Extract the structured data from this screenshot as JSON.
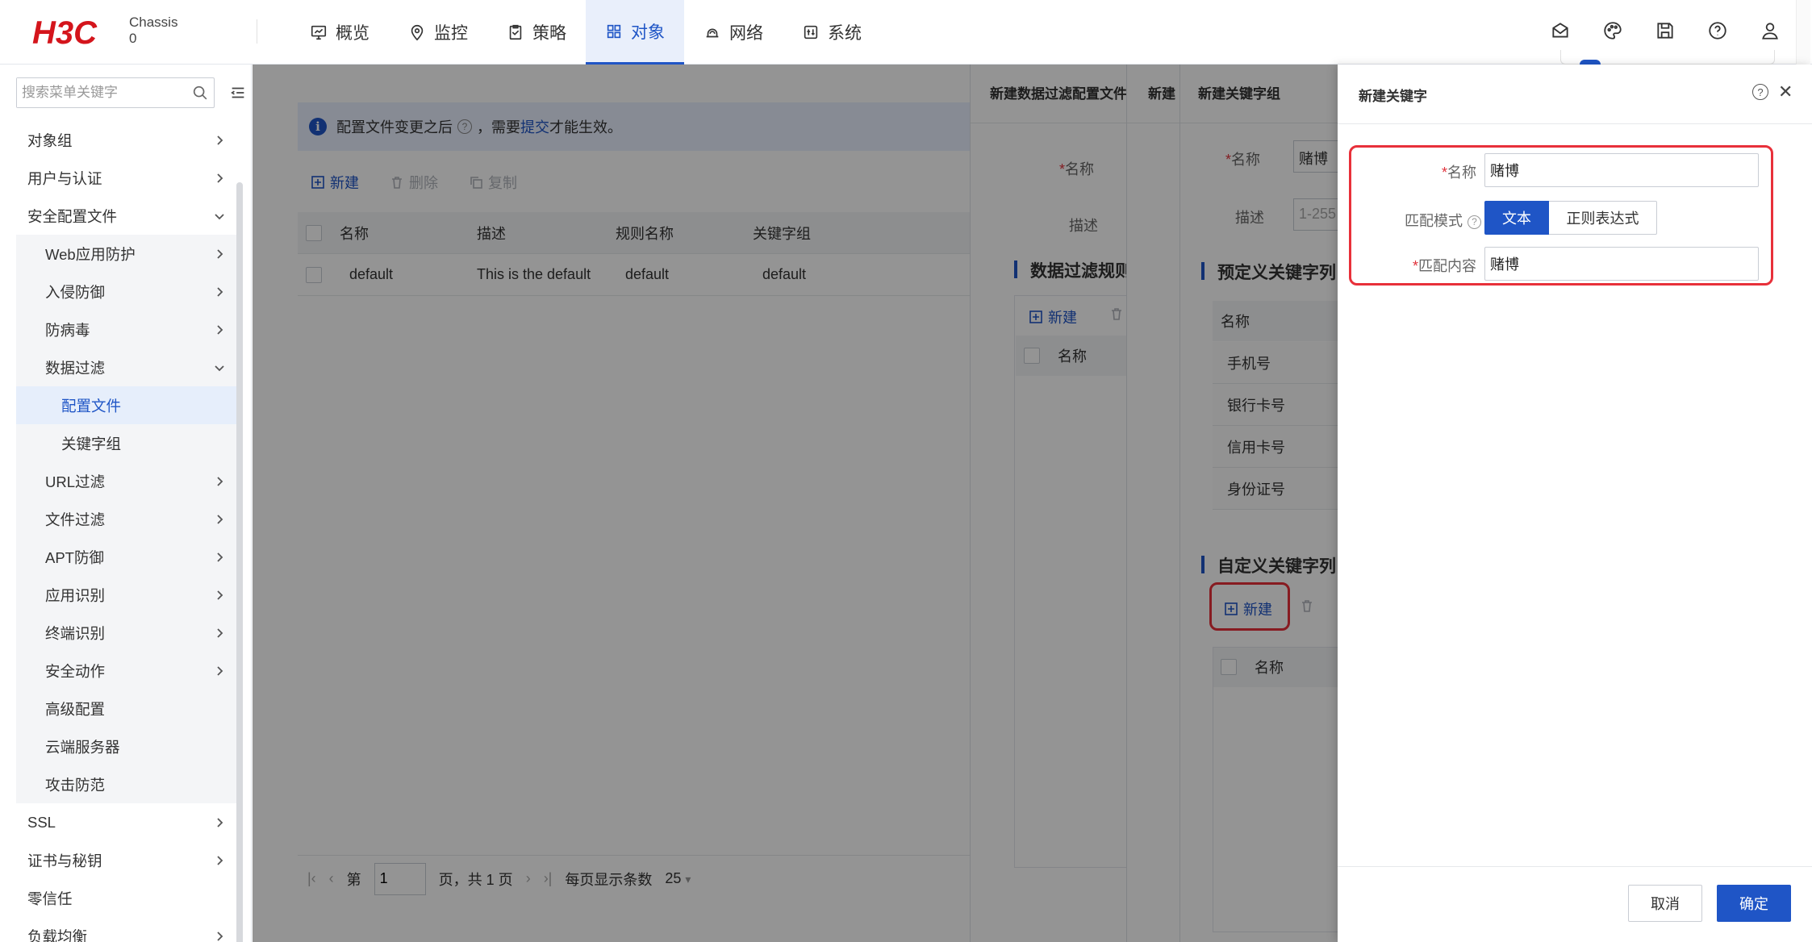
{
  "brand": {
    "logo": "H3C",
    "product": "Chassis",
    "slot": "0"
  },
  "nav": [
    {
      "label": "概览",
      "icon": "dashboard-icon"
    },
    {
      "label": "监控",
      "icon": "monitor-icon"
    },
    {
      "label": "策略",
      "icon": "policy-icon"
    },
    {
      "label": "对象",
      "icon": "object-icon",
      "active": true
    },
    {
      "label": "网络",
      "icon": "network-icon"
    },
    {
      "label": "系统",
      "icon": "system-icon"
    }
  ],
  "top_actions": [
    "message-icon",
    "theme-icon",
    "save-icon",
    "help-icon",
    "user-icon"
  ],
  "sidebar": {
    "search_placeholder": "搜索菜单关键字",
    "items": [
      {
        "label": "对象组",
        "level": 1,
        "chevron": "right"
      },
      {
        "label": "用户与认证",
        "level": 1,
        "chevron": "right"
      },
      {
        "label": "安全配置文件",
        "level": 1,
        "chevron": "down"
      },
      {
        "label": "Web应用防护",
        "level": 2,
        "chevron": "right"
      },
      {
        "label": "入侵防御",
        "level": 2,
        "chevron": "right"
      },
      {
        "label": "防病毒",
        "level": 2,
        "chevron": "right"
      },
      {
        "label": "数据过滤",
        "level": 2,
        "chevron": "down"
      },
      {
        "label": "配置文件",
        "level": 3,
        "selected": true
      },
      {
        "label": "关键字组",
        "level": 3
      },
      {
        "label": "URL过滤",
        "level": 2,
        "chevron": "right"
      },
      {
        "label": "文件过滤",
        "level": 2,
        "chevron": "right"
      },
      {
        "label": "APT防御",
        "level": 2,
        "chevron": "right"
      },
      {
        "label": "应用识别",
        "level": 2,
        "chevron": "right"
      },
      {
        "label": "终端识别",
        "level": 2,
        "chevron": "right"
      },
      {
        "label": "安全动作",
        "level": 2,
        "chevron": "right"
      },
      {
        "label": "高级配置",
        "level": 2
      },
      {
        "label": "云端服务器",
        "level": 2
      },
      {
        "label": "攻击防范",
        "level": 2
      },
      {
        "label": "SSL",
        "level": 1,
        "chevron": "right"
      },
      {
        "label": "证书与秘钥",
        "level": 1,
        "chevron": "right"
      },
      {
        "label": "零信任",
        "level": 1
      },
      {
        "label": "负载均衡",
        "level": 1,
        "chevron": "right"
      }
    ]
  },
  "main": {
    "notice": {
      "prefix": "配置文件变更之后",
      "middle": "，需要 ",
      "link": "提交",
      "suffix": "才能生效。"
    },
    "toolbar": {
      "new": "新建",
      "delete": "删除",
      "copy": "复制"
    },
    "columns": [
      "名称",
      "描述",
      "规则名称",
      "关键字组"
    ],
    "rows": [
      [
        "default",
        "This is the default",
        "default",
        "default"
      ]
    ],
    "pager": {
      "page_prefix": "第",
      "page_value": "1",
      "page_suffix": "页，共 1 页",
      "per_page_label": "每页显示条数",
      "per_page_value": "25"
    }
  },
  "drawer1": {
    "title": "新建数据过滤配置文件",
    "name_label": "名称",
    "desc_label": "描述",
    "section": "数据过滤规则",
    "new": "新建",
    "col_name": "名称"
  },
  "drawer2": {
    "title": "新建"
  },
  "drawer3": {
    "title": "新建关键字组",
    "name_label": "名称",
    "name_value": "赌博",
    "desc_label": "描述",
    "desc_placeholder": "1-255",
    "predefined_section": "预定义关键字列",
    "predefined_col": "名称",
    "predefined_rows": [
      "手机号",
      "银行卡号",
      "信用卡号",
      "身份证号"
    ],
    "custom_section": "自定义关键字列",
    "new": "新建",
    "custom_col": "名称"
  },
  "front_drawer": {
    "title": "新建关键字",
    "name_label": "名称",
    "name_value": "赌博",
    "mode_label": "匹配模式",
    "mode_options": [
      "文本",
      "正则表达式"
    ],
    "mode_selected": "文本",
    "content_label": "匹配内容",
    "content_value": "赌博",
    "cancel": "取消",
    "ok": "确定"
  },
  "colors": {
    "primary": "#1f55c6",
    "highlight": "#e8303a",
    "required": "#e0323b"
  }
}
